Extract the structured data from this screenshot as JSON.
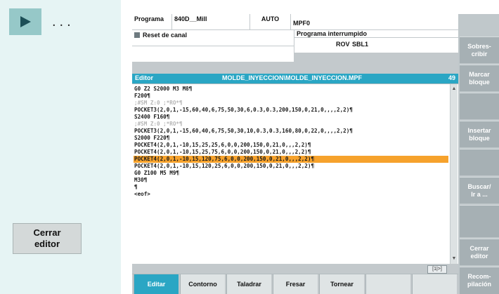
{
  "left_panel": {
    "dots": "...",
    "close_editor_button": "Cerrar\neditor"
  },
  "header": {
    "programa_label": "Programa",
    "machine": "840D__Mill",
    "mode": "AUTO",
    "program_name": "MPF0",
    "reset_label": "Reset de canal",
    "status_message": "Programa interrumpido",
    "rov": "ROV",
    "sbl": "SBL1"
  },
  "editor": {
    "label": "Editor",
    "path": "MOLDE_INYECCION\\MOLDE_INYECCION.MPF",
    "line_count": "49",
    "footer_indicator": "[1|>]",
    "lines": [
      {
        "text": "G0 Z2 S2000 M3 M8¶",
        "style": "normal"
      },
      {
        "text": "F200¶",
        "style": "normal"
      },
      {
        "text": ";#SM Z:0 ;*RO*¶",
        "style": "dim"
      },
      {
        "text": "POCKET3(2,0,1,-15,60,40,6,75,50,30,6,0.3,0.3,200,150,0,21,0,,,,2,2)¶",
        "style": "normal"
      },
      {
        "text": "S2400 F160¶",
        "style": "normal"
      },
      {
        "text": ";#SM Z:0 ;*RO*¶",
        "style": "dim"
      },
      {
        "text": "POCKET3(2,0,1,-15,60,40,6,75,50,30,10,0.3,0.3,160,80,0,22,0,,,,2,2)¶",
        "style": "normal"
      },
      {
        "text": "S2000 F220¶",
        "style": "normal"
      },
      {
        "text": "POCKET4(2,0,1,-10,15,25,25,6,0,0,200,150,0,21,0,,,2,2)¶",
        "style": "normal"
      },
      {
        "text": "POCKET4(2,0,1,-10,15,25,75,6,0,0,200,150,0,21,0,,,2,2)¶",
        "style": "normal"
      },
      {
        "text": "POCKET4(2,0,1,-10,15,120,75,6,0,0,200,150,0,21,0,,,2,2)¶",
        "style": "highlight"
      },
      {
        "text": "POCKET4(2,0,1,-10,15,120,25,6,0,0,200,150,0,21,0,,,2,2)¶",
        "style": "normal"
      },
      {
        "text": "G0 Z100 M5 M9¶",
        "style": "normal"
      },
      {
        "text": "M30¶",
        "style": "normal"
      },
      {
        "text": "¶",
        "style": "normal"
      },
      {
        "text": "<eof>",
        "style": "normal"
      }
    ]
  },
  "vertical_softkeys": [
    {
      "label": "",
      "style": "blank"
    },
    {
      "label": "Sobres-\ncribir",
      "style": "key"
    },
    {
      "label": "Marcar\nbloque",
      "style": "key"
    },
    {
      "label": "",
      "style": "key"
    },
    {
      "label": "Insertar\nbloque",
      "style": "key"
    },
    {
      "label": "",
      "style": "key"
    },
    {
      "label": "Buscar/\nIr a ...",
      "style": "key"
    },
    {
      "label": "",
      "style": "key"
    },
    {
      "label": "Cerrar\neditor",
      "style": "key"
    },
    {
      "label": "Recom-\npilación",
      "style": "key"
    }
  ],
  "horizontal_softkeys": [
    {
      "label": "Editar",
      "active": true
    },
    {
      "label": "Contorno",
      "active": false
    },
    {
      "label": "Taladrar",
      "active": false
    },
    {
      "label": "Fresar",
      "active": false
    },
    {
      "label": "Tornear",
      "active": false
    },
    {
      "label": "",
      "active": false
    },
    {
      "label": "",
      "active": false
    }
  ],
  "colors": {
    "accent_blue": "#2aa6c4",
    "highlight_orange": "#f6a22c",
    "softkey_gray": "#a6b0b4"
  }
}
